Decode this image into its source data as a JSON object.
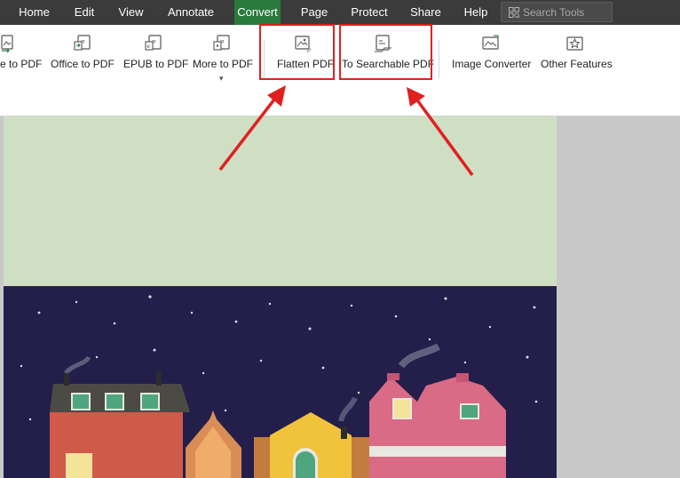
{
  "menu": {
    "items": [
      {
        "label": "Home"
      },
      {
        "label": "Edit"
      },
      {
        "label": "View"
      },
      {
        "label": "Annotate"
      },
      {
        "label": "Convert",
        "active": true
      },
      {
        "label": "Page"
      },
      {
        "label": "Protect"
      },
      {
        "label": "Share"
      },
      {
        "label": "Help"
      }
    ],
    "search_placeholder": "Search Tools"
  },
  "toolbar": {
    "tools": [
      {
        "label": "e to PDF",
        "icon": "image-to-pdf-icon"
      },
      {
        "label": "Office to PDF",
        "icon": "office-to-pdf-icon"
      },
      {
        "label": "EPUB to PDF",
        "icon": "epub-to-pdf-icon"
      },
      {
        "label": "More to PDF",
        "icon": "more-to-pdf-icon"
      },
      {
        "label": "Flatten PDF",
        "icon": "flatten-pdf-icon"
      },
      {
        "label": "To Searchable PDF",
        "icon": "searchable-pdf-icon"
      },
      {
        "label": "Image Converter",
        "icon": "image-converter-icon"
      },
      {
        "label": "Other Features",
        "icon": "other-features-icon"
      }
    ]
  },
  "colors": {
    "menubar": "#3b3b3b",
    "active_tab": "#2a7a3d",
    "highlight": "#e02020",
    "doc_top": "#cfdfc4",
    "doc_night": "#231f4a"
  }
}
